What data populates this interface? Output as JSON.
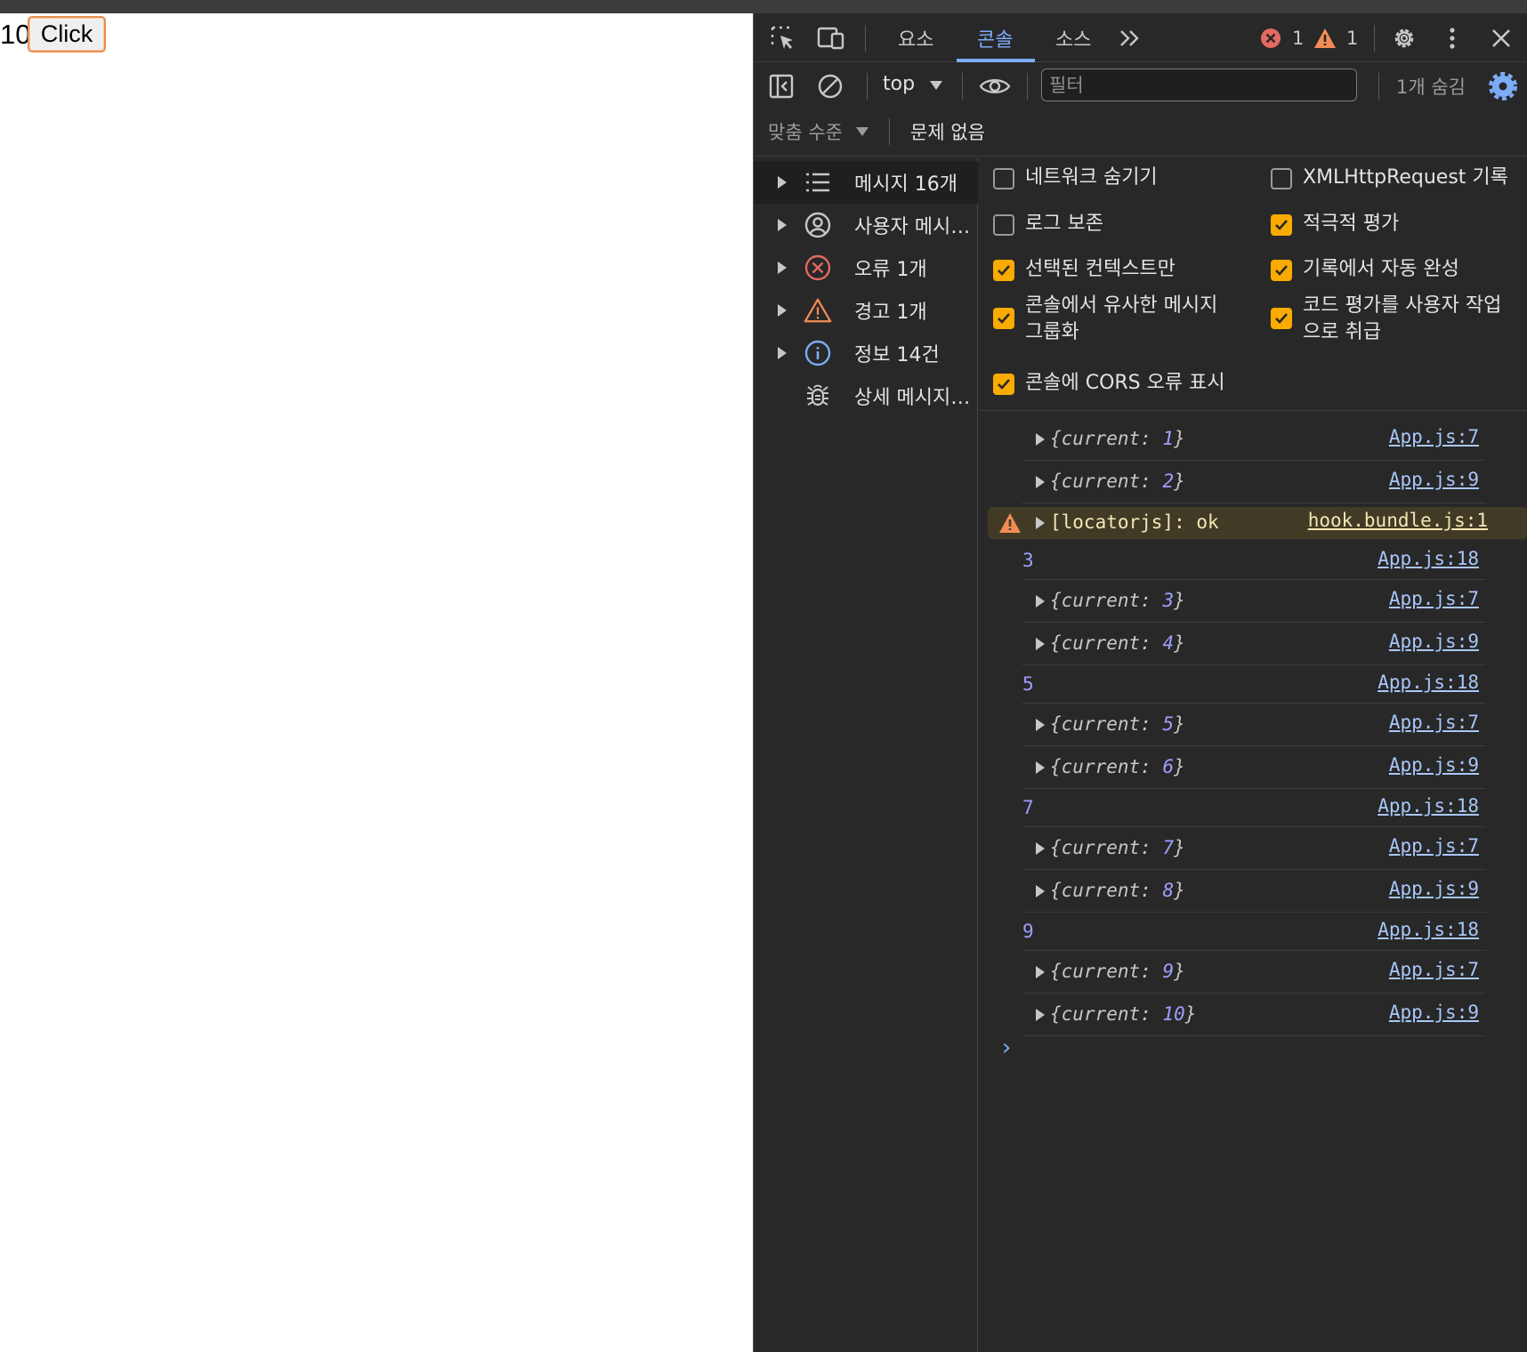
{
  "page": {
    "counter": "10",
    "button_label": "Click"
  },
  "devtools": {
    "tabs": [
      "요소",
      "콘솔",
      "소스"
    ],
    "active_tab": "콘솔",
    "error_count": "1",
    "warning_count": "1",
    "context": "top",
    "filter_placeholder": "필터",
    "hidden_count": "1개 숨김",
    "levels_label": "맞춤 수준",
    "issues_label": "문제 없음",
    "sidebar": [
      {
        "label": "메시지 16개",
        "icon": "list-icon"
      },
      {
        "label": "사용자 메시…",
        "icon": "user-icon"
      },
      {
        "label": "오류 1개",
        "icon": "error-icon"
      },
      {
        "label": "경고 1개",
        "icon": "warning-icon"
      },
      {
        "label": "정보 14건",
        "icon": "info-icon"
      },
      {
        "label": "상세 메시지…",
        "icon": "bug-icon"
      }
    ],
    "settings": {
      "hide_network": "네트워크 숨기기",
      "xhr_log": "XMLHttpRequest 기록",
      "preserve_log": "로그 보존",
      "eager_eval": "적극적 평가",
      "selected_context": "선택된 컨텍스트만",
      "autocomplete": "기록에서 자동 완성",
      "group_similar_1": "콘솔에서 유사한 메시지",
      "group_similar_2": "그룹화",
      "user_gesture_1": "코드 평가를 사용자 작업",
      "user_gesture_2": "으로 취급",
      "cors_errors": "콘솔에 CORS 오류 표시"
    },
    "logs": [
      {
        "kind": "obj",
        "key": "current",
        "value": "1",
        "source": "App.js:7"
      },
      {
        "kind": "obj",
        "key": "current",
        "value": "2",
        "source": "App.js:9"
      },
      {
        "kind": "warn",
        "text": "[locatorjs]: ok",
        "source": "hook.bundle.js:1"
      },
      {
        "kind": "num",
        "value": "3",
        "source": "App.js:18"
      },
      {
        "kind": "obj",
        "key": "current",
        "value": "3",
        "source": "App.js:7"
      },
      {
        "kind": "obj",
        "key": "current",
        "value": "4",
        "source": "App.js:9"
      },
      {
        "kind": "num",
        "value": "5",
        "source": "App.js:18"
      },
      {
        "kind": "obj",
        "key": "current",
        "value": "5",
        "source": "App.js:7"
      },
      {
        "kind": "obj",
        "key": "current",
        "value": "6",
        "source": "App.js:9"
      },
      {
        "kind": "num",
        "value": "7",
        "source": "App.js:18"
      },
      {
        "kind": "obj",
        "key": "current",
        "value": "7",
        "source": "App.js:7"
      },
      {
        "kind": "obj",
        "key": "current",
        "value": "8",
        "source": "App.js:9"
      },
      {
        "kind": "num",
        "value": "9",
        "source": "App.js:18"
      },
      {
        "kind": "obj",
        "key": "current",
        "value": "9",
        "source": "App.js:7"
      },
      {
        "kind": "obj",
        "key": "current",
        "value": "10",
        "source": "App.js:9"
      }
    ]
  }
}
